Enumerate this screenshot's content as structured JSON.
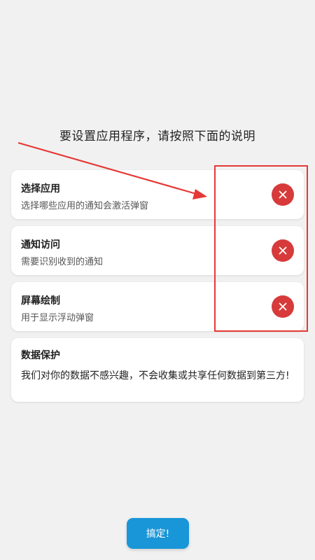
{
  "headline": "要设置应用程序，请按照下面的说明",
  "permissions": [
    {
      "title": "选择应用",
      "subtitle": "选择哪些应用的通知会激活弹窗",
      "status_icon": "close-icon"
    },
    {
      "title": "通知访问",
      "subtitle": "需要识别收到的通知",
      "status_icon": "close-icon"
    },
    {
      "title": "屏幕绘制",
      "subtitle": "用于显示浮动弹窗",
      "status_icon": "close-icon"
    }
  ],
  "privacy": {
    "title": "数据保护",
    "body": "我们对你的数据不感兴趣，不会收集或共享任何数据到第三方!"
  },
  "ok_button": {
    "label": "搞定!"
  },
  "colors": {
    "background": "#f1f1f1",
    "status_red": "#d73a3a",
    "annotation_red": "#e53935",
    "accent_blue": "#1996d8"
  }
}
